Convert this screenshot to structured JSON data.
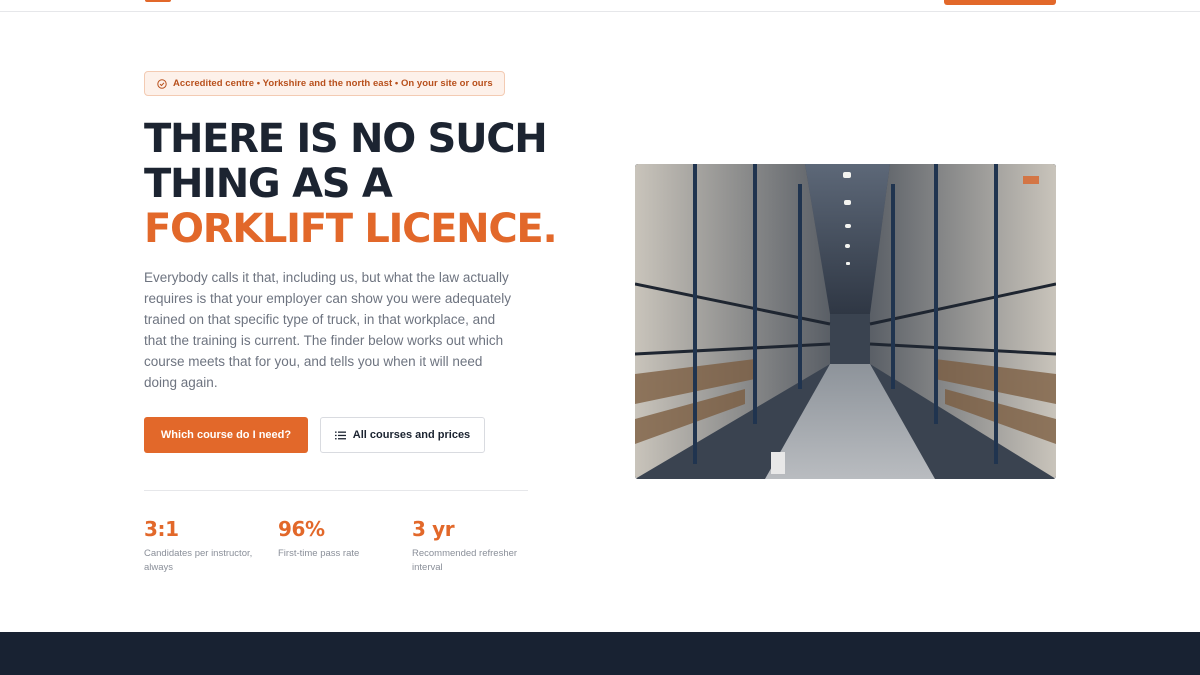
{
  "badge": {
    "icon": "check-circle-icon",
    "text": "Accredited centre • Yorkshire and the north east • On your site or ours"
  },
  "hero": {
    "headline_line1": "THERE IS NO SUCH",
    "headline_line2": "THING AS A",
    "headline_accent": "FORKLIFT LICENCE.",
    "intro": "Everybody calls it that, including us, but what the law actually requires is that your employer can show you were adequately trained on that specific type of truck, in that workplace, and that the training is current. The finder below works out which course meets that for you, and tells you when it will need doing again."
  },
  "actions": {
    "primary_label": "Which course do I need?",
    "secondary_label": "All courses and prices",
    "secondary_icon": "list-icon"
  },
  "stats": [
    {
      "value": "3:1",
      "label": "Candidates per instructor, always"
    },
    {
      "value": "96%",
      "label": "First-time pass rate"
    },
    {
      "value": "3 yr",
      "label": "Recommended refresher interval"
    }
  ],
  "colors": {
    "accent": "#e2682a",
    "heading": "#1c2431",
    "body_text": "#6e7480",
    "footer_band": "#182232"
  }
}
